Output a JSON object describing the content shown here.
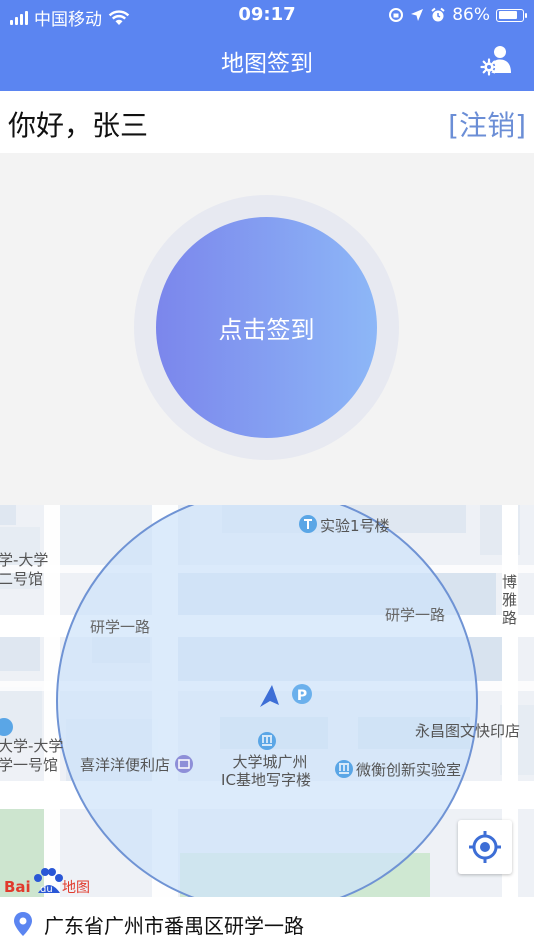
{
  "status_bar": {
    "carrier": "中国移动",
    "time": "09:17",
    "battery_percent": "86%",
    "battery_level": 0.86
  },
  "nav": {
    "title": "地图签到",
    "user_settings_icon": "user-settings-icon"
  },
  "greeting": {
    "text": "你好，张三",
    "logout_label": "[注销]"
  },
  "checkin": {
    "button_label": "点击签到"
  },
  "map": {
    "labels": {
      "lab_building": "实验1号楼",
      "univ_hall_top_1": "学-大学",
      "univ_hall_top_2": "二号馆",
      "road_left": "研学一路",
      "road_right": "研学一路",
      "boya_1": "博",
      "boya_2": "雅",
      "boya_3": "路",
      "print_shop": "永昌图文快印店",
      "univ_hall_bottom_1": "大学-大学",
      "univ_hall_bottom_2": "学一号馆",
      "store": "喜洋洋便利店",
      "office_1": "大学城广州",
      "office_2": "IC基地写字楼",
      "weiheng_lab": "微衡创新实验室",
      "brand": "地图"
    },
    "colors": {
      "accuracy_fill": "#cfe3fa",
      "accuracy_stroke": "#6f93d4",
      "poi": "#5aa6e6",
      "heading_arrow": "#3d6ed6"
    }
  },
  "address": {
    "text": "广东省广州市番禺区研学一路"
  },
  "colors": {
    "header": "#5b85f1",
    "logout": "#6b8ed6",
    "gradient_start": "#7b86ec",
    "gradient_end": "#8db7f7"
  }
}
